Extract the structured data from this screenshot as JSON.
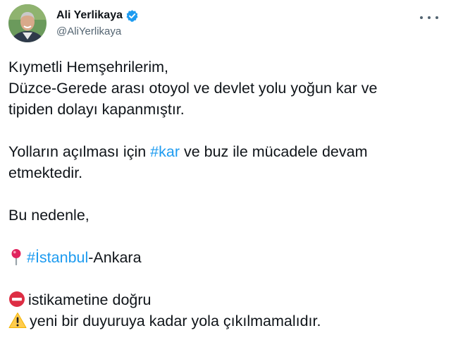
{
  "author": {
    "display_name": "Ali Yerlikaya",
    "handle": "@AliYerlikaya",
    "verified": true
  },
  "tweet": {
    "lines": [
      "Kıymetli Hemşehrilerim,",
      "Düzce-Gerede arası otoyol ve devlet yolu yoğun kar ve",
      "tipiden dolayı kapanmıştır."
    ],
    "para2": {
      "before": "Yolların açılması için ",
      "hashtag": "#kar",
      "after": " ve buz ile mücadele devam",
      "line2": "etmektedir."
    },
    "para3": "Bu nedenle,",
    "route": {
      "hashtag": "#İstanbul",
      "after": "-Ankara"
    },
    "direction": "istikametine doğru",
    "warning": "yeni bir duyuruya kadar yola çıkılmamalıdır."
  },
  "icons": {
    "verified": "verified-badge-icon",
    "more": "more-options-icon",
    "pin": "round-pushpin-icon",
    "no_entry": "no-entry-icon",
    "warning": "warning-icon"
  },
  "colors": {
    "link": "#1d9bf0",
    "text": "#0f1419",
    "secondary": "#536471"
  }
}
